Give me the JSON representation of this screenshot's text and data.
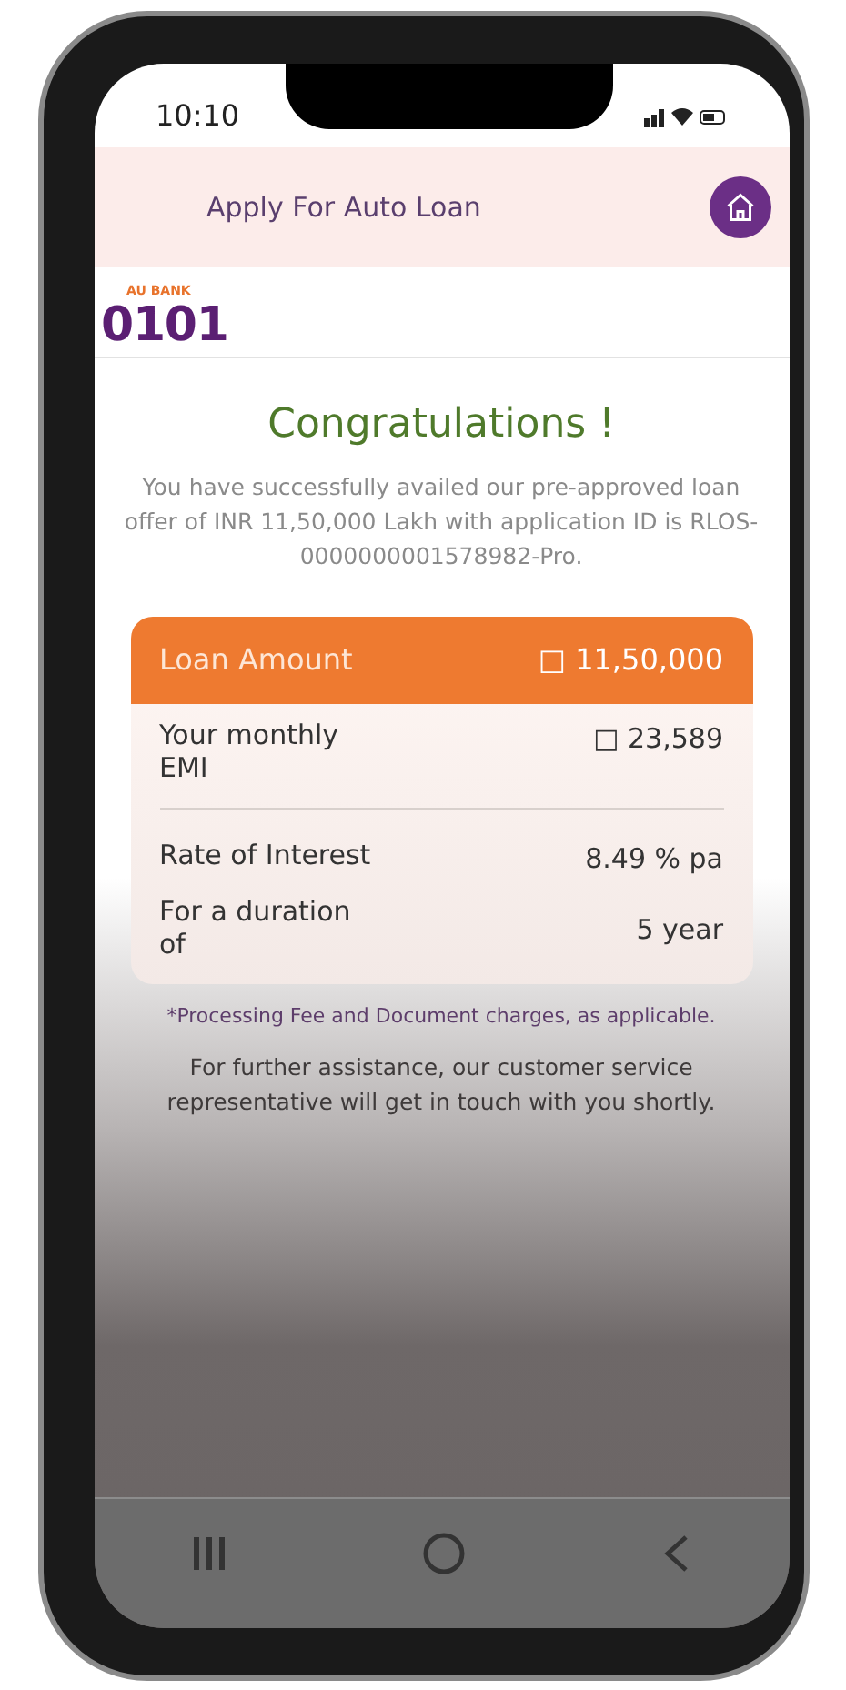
{
  "status_bar": {
    "time": "10:10"
  },
  "header": {
    "title": "Apply For Auto Loan"
  },
  "logo": {
    "brand": "AU BANK",
    "mark": "0101"
  },
  "message": {
    "title": "Congratulations !",
    "body": "You have successfully availed our pre-approved loan offer of INR 11,50,000 Lakh with application ID is RLOS-0000000001578982-Pro."
  },
  "summary": {
    "rows": [
      {
        "kind": "header",
        "label": "Loan Amount",
        "value": "□ 11,50,000"
      },
      {
        "kind": "row",
        "label": "Your monthly EMI",
        "value": "□ 23,589"
      },
      {
        "kind": "divider"
      },
      {
        "kind": "row",
        "label": "Rate of Interest",
        "value": "8.49 % pa"
      },
      {
        "kind": "row",
        "label": "For a duration of",
        "value": "5 year"
      }
    ]
  },
  "footnote": "*Processing Fee and Document charges, as applicable.",
  "assistance": "For further assistance, our customer service representative will get in touch with you shortly."
}
